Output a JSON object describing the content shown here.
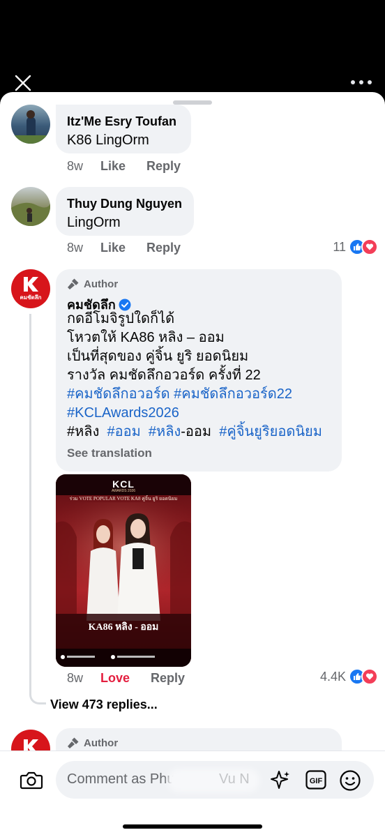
{
  "comments": [
    {
      "name": "Itz'Me Esry Toufan",
      "text": "K86 LingOrm",
      "time": "8w",
      "like": "Like",
      "reply": "Reply"
    },
    {
      "name": "Thuy Dung Nguyen",
      "text": "LingOrm",
      "time": "8w",
      "like": "Like",
      "reply": "Reply",
      "reaction_count": "11"
    }
  ],
  "author_post": {
    "badge": "Author",
    "name": "คมชัดลึก",
    "avatar_text": "คมชัดลึก",
    "lines": [
      "กดอีโมจิรูปใดก็ได้",
      "โหวตให้ KA86 หลิง – ออม",
      "เป็นที่สุดของ คู่จิ้น ยูริ ยอดนิยม",
      "รางวัล คมชัดลึกอวอร์ด ครั้งที่ 22"
    ],
    "hashtags_line1": [
      "#คมชัดลึกอวอร์ด",
      "#คมชัดลึกอวอร์ด22"
    ],
    "hashtags_line2": "#KCLAwards2026",
    "hashtags_line3": [
      "#หลิง",
      "#ออม",
      "#หลิง",
      "-ออม",
      "#คู่จิ้นยูริยอดนิยม"
    ],
    "see_translation": "See translation",
    "time": "8w",
    "love": "Love",
    "reply": "Reply",
    "reaction_count": "4.4K",
    "view_replies": "View 473 replies...",
    "image": {
      "brand": "KCL",
      "brand_sub": "AWARDS 2026",
      "header": "ร่วม VOTE POPULAR VOTE KA8 คู่จิ้น ยูริ ยอดนิยม",
      "candidate": "KA86 หลิง - ออม"
    }
  },
  "next_post": {
    "badge": "Author"
  },
  "composer": {
    "placeholder": "Comment as Phu",
    "placeholder_tail": "Vu N"
  },
  "colors": {
    "link": "#1a64c8",
    "love": "#e41e3f",
    "like_blue": "#1877f2",
    "brand_red": "#d7151b"
  }
}
